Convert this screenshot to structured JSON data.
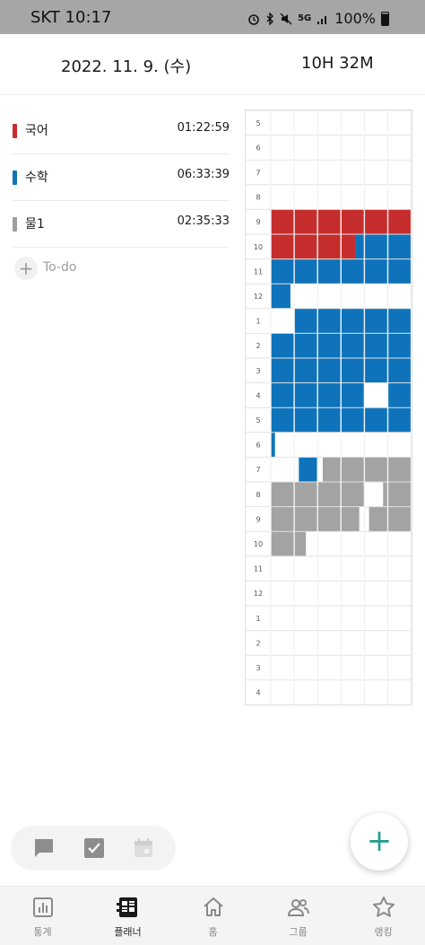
{
  "status_bar": {
    "carrier_time": "SKT 10:17",
    "network": "5G",
    "battery": "100%",
    "icons": [
      "alarm-icon",
      "bluetooth-icon",
      "mute-icon",
      "wifi-icon",
      "signal-icon",
      "battery-icon"
    ]
  },
  "header": {
    "date": "2022. 11. 9. (수)",
    "total": "10H 32M"
  },
  "subjects": [
    {
      "name": "국어",
      "time": "01:22:59",
      "color": "#c62d2d"
    },
    {
      "name": "수학",
      "time": "06:33:39",
      "color": "#0e73bb"
    },
    {
      "name": "물1",
      "time": "02:35:33",
      "color": "#9e9e9e"
    }
  ],
  "todo": {
    "label": "To-do"
  },
  "timeline": {
    "hours": [
      "5",
      "6",
      "7",
      "8",
      "9",
      "10",
      "11",
      "12",
      "1",
      "2",
      "3",
      "4",
      "5",
      "6",
      "7",
      "8",
      "9",
      "10",
      "11",
      "12",
      "1",
      "2",
      "3",
      "4"
    ],
    "colors": {
      "kor": "#c62d2d",
      "math": "#0e73bb",
      "phys": "#a3a3a3"
    },
    "blocks": [
      {
        "subject": "kor",
        "row": 4,
        "from": 0,
        "to": 1
      },
      {
        "subject": "kor",
        "row": 5,
        "from": 0,
        "to": 0.6
      },
      {
        "subject": "math",
        "row": 5,
        "from": 0.6,
        "to": 1
      },
      {
        "subject": "math",
        "row": 6,
        "from": 0,
        "to": 1
      },
      {
        "subject": "math",
        "row": 7,
        "from": 0,
        "to": 0.14
      },
      {
        "subject": "math",
        "row": 8,
        "from": 0.17,
        "to": 1
      },
      {
        "subject": "math",
        "row": 9,
        "from": 0,
        "to": 1
      },
      {
        "subject": "math",
        "row": 10,
        "from": 0,
        "to": 1
      },
      {
        "subject": "math",
        "row": 11,
        "from": 0,
        "to": 0.67
      },
      {
        "subject": "math",
        "row": 11,
        "from": 0.83,
        "to": 1
      },
      {
        "subject": "math",
        "row": 12,
        "from": 0,
        "to": 1
      },
      {
        "subject": "math",
        "row": 13,
        "from": 0,
        "to": 0.03
      },
      {
        "subject": "math",
        "row": 14,
        "from": 0.2,
        "to": 0.33
      },
      {
        "subject": "phys",
        "row": 14,
        "from": 0.37,
        "to": 1
      },
      {
        "subject": "phys",
        "row": 15,
        "from": 0,
        "to": 0.67
      },
      {
        "subject": "phys",
        "row": 15,
        "from": 0.8,
        "to": 1
      },
      {
        "subject": "phys",
        "row": 16,
        "from": 0,
        "to": 0.63
      },
      {
        "subject": "phys",
        "row": 16,
        "from": 0.7,
        "to": 1
      },
      {
        "subject": "phys",
        "row": 17,
        "from": 0,
        "to": 0.25
      }
    ]
  },
  "tools": [
    "chat-icon",
    "check-icon",
    "calendar-icon"
  ],
  "bottom_nav": [
    {
      "label": "통계",
      "icon": "stats-icon",
      "active": false
    },
    {
      "label": "플래너",
      "icon": "planner-icon",
      "active": true
    },
    {
      "label": "홈",
      "icon": "home-icon",
      "active": false
    },
    {
      "label": "그룹",
      "icon": "group-icon",
      "active": false
    },
    {
      "label": "랭킹",
      "icon": "ranking-icon",
      "active": false
    }
  ]
}
